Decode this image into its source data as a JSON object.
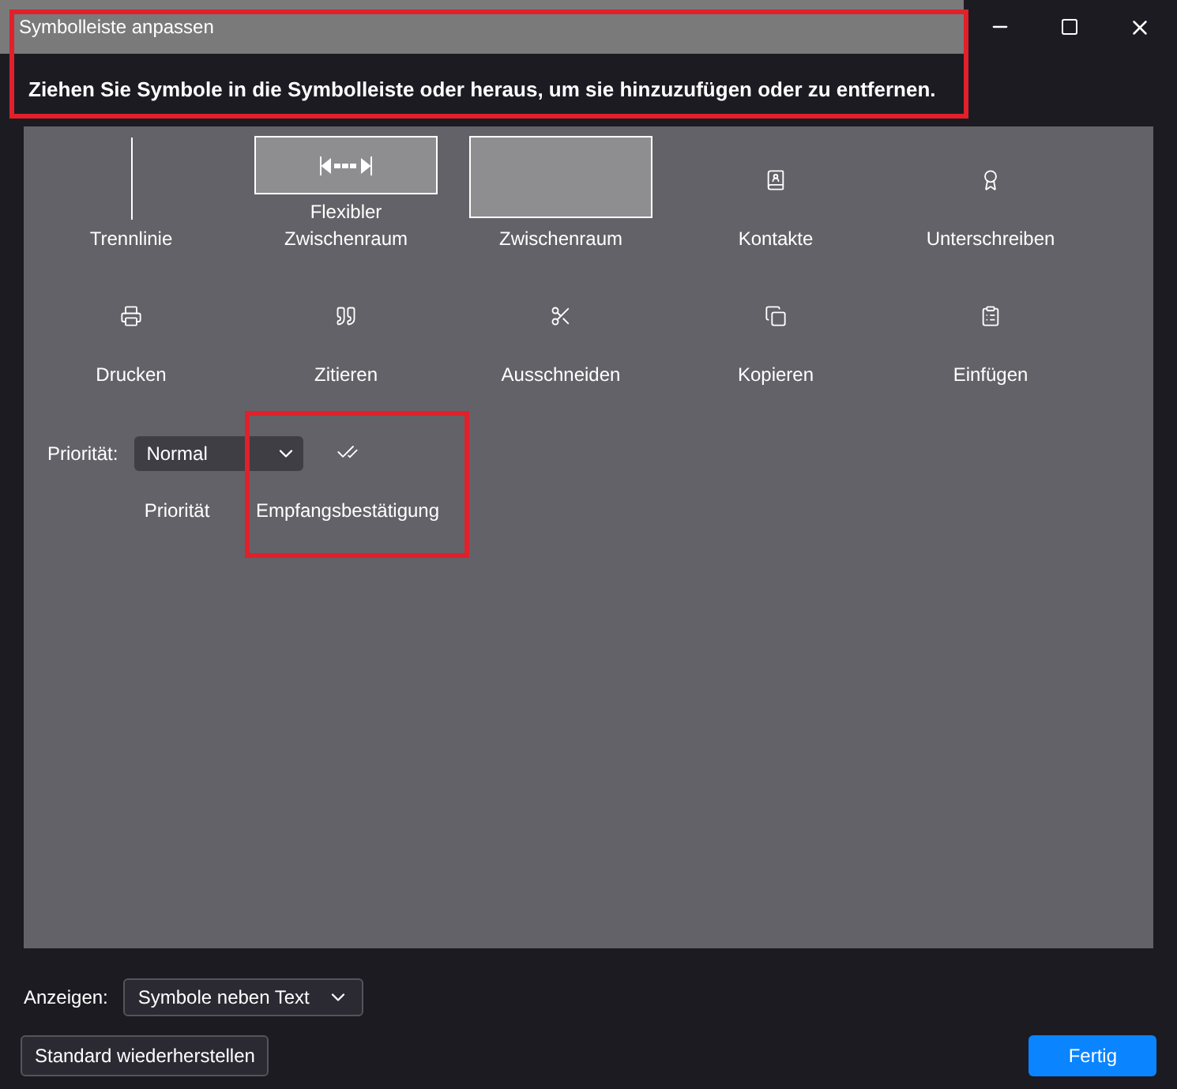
{
  "window": {
    "title": "Symbolleiste anpassen"
  },
  "instruction": "Ziehen Sie Symbole in die Symbolleiste oder heraus, um sie hinzuzufügen oder zu entfernen.",
  "palette": [
    [
      {
        "kind": "separator",
        "label": "Trennlinie"
      },
      {
        "kind": "flexspace",
        "label": "Flexibler Zwischenraum"
      },
      {
        "kind": "space",
        "label": "Zwischenraum"
      },
      {
        "kind": "icon",
        "label": "Kontakte"
      },
      {
        "kind": "icon",
        "label": "Unterschreiben"
      }
    ],
    [
      {
        "kind": "icon",
        "label": "Drucken"
      },
      {
        "kind": "icon",
        "label": "Zitieren"
      },
      {
        "kind": "icon",
        "label": "Ausschneiden"
      },
      {
        "kind": "icon",
        "label": "Kopieren"
      },
      {
        "kind": "icon",
        "label": "Einfügen"
      }
    ],
    [
      {
        "kind": "select",
        "label": "Priorität",
        "field_label": "Priorität:",
        "value": "Normal"
      },
      {
        "kind": "icon",
        "label": "Empfangsbestätigung"
      }
    ]
  ],
  "show": {
    "label": "Anzeigen:",
    "value": "Symbole neben Text"
  },
  "buttons": [
    {
      "label": "Standard wiederherstellen",
      "primary": false
    },
    {
      "label": "Fertig",
      "primary": true
    }
  ]
}
